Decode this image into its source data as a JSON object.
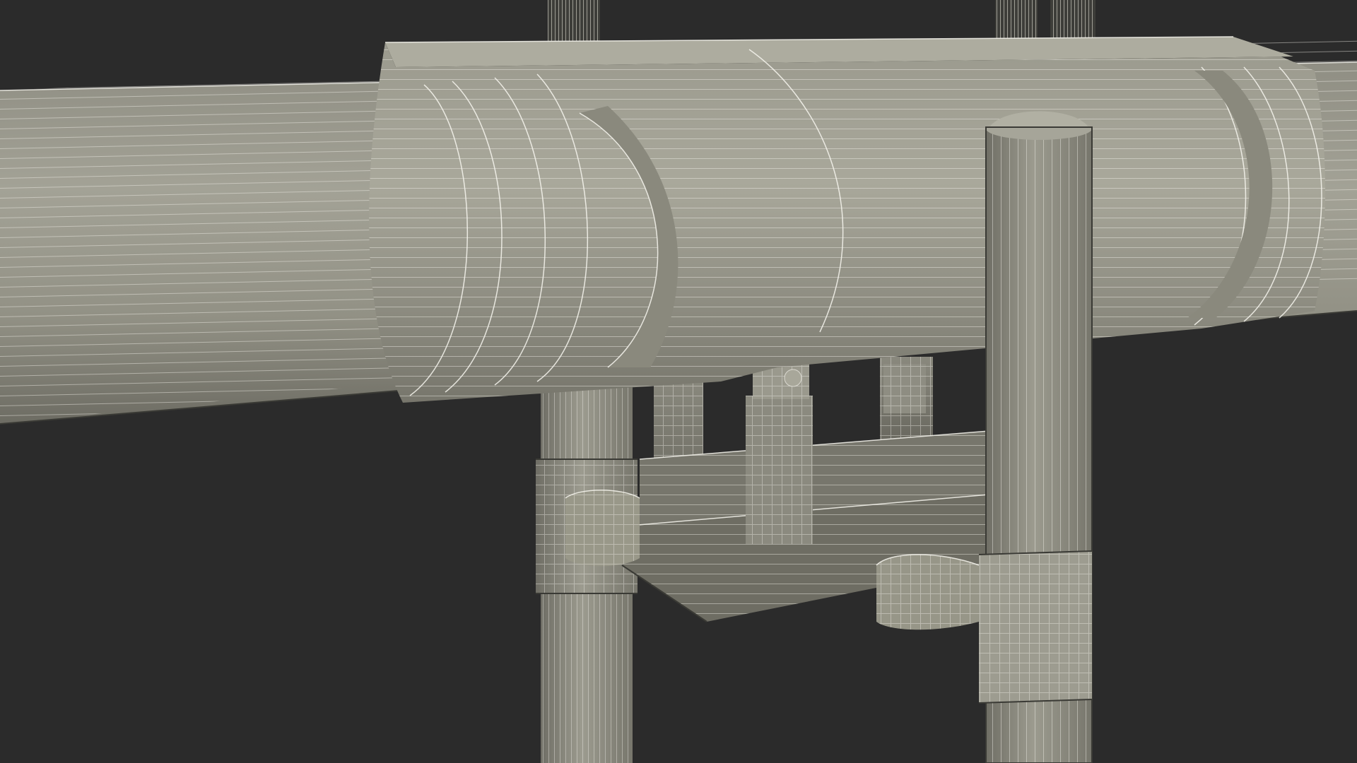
{
  "scene": {
    "description_free": true,
    "colors": {
      "background": "#2b2b2b",
      "surface_light": "#a09f92",
      "surface_mid": "#8c8b7f",
      "surface_dark": "#6f6e64",
      "wire": "#f2f1ea",
      "shadow": "#1e1e1c"
    }
  }
}
